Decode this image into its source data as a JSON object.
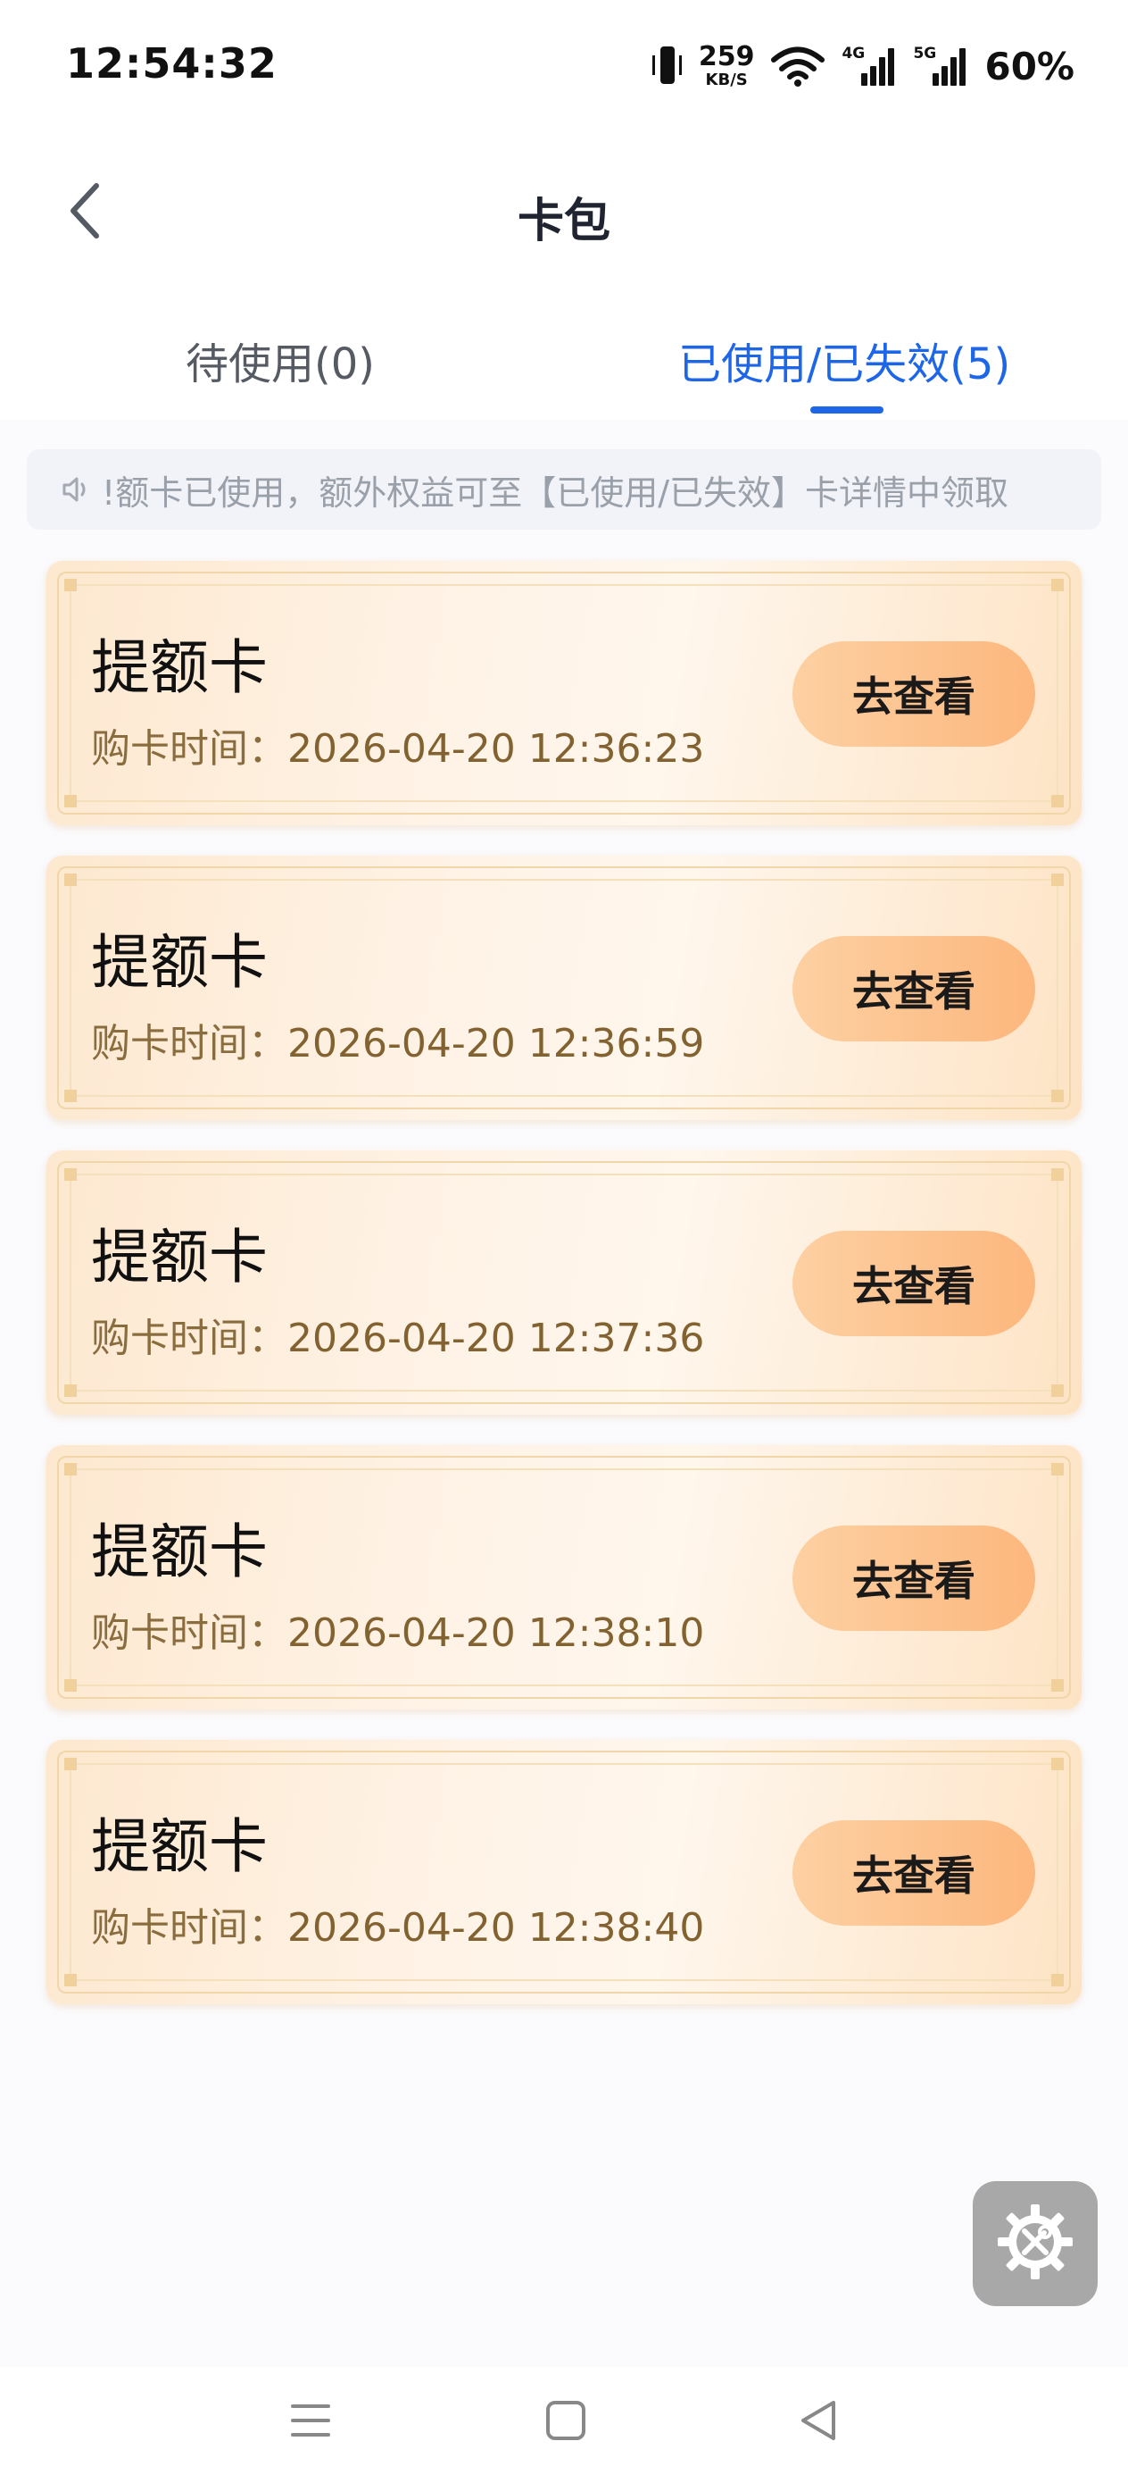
{
  "status_bar": {
    "time": "12:54:32",
    "net_speed_value": "259",
    "net_speed_unit": "KB/S",
    "signal_1_label": "4G",
    "signal_2_label": "5G",
    "battery": "60%",
    "icons": [
      "vibrate-icon",
      "wifi-icon",
      "signal-icon",
      "signal-icon"
    ]
  },
  "header": {
    "title": "卡包",
    "back_icon": "chevron-left-icon"
  },
  "tabs": [
    {
      "label": "待使用(0)",
      "active": false
    },
    {
      "label": "已使用/已失效(5)",
      "active": true
    }
  ],
  "notice": {
    "icon": "speaker-icon",
    "text": "!额卡已使用，额外权益可至【已使用/已失效】卡详情中领取"
  },
  "cards": [
    {
      "title": "提额卡",
      "time_label": "购卡时间：",
      "time_value": "2026-04-20 12:36:23",
      "button": "去查看"
    },
    {
      "title": "提额卡",
      "time_label": "购卡时间：",
      "time_value": "2026-04-20 12:36:59",
      "button": "去查看"
    },
    {
      "title": "提额卡",
      "time_label": "购卡时间：",
      "time_value": "2026-04-20 12:37:36",
      "button": "去查看"
    },
    {
      "title": "提额卡",
      "time_label": "购卡时间：",
      "time_value": "2026-04-20 12:38:10",
      "button": "去查看"
    },
    {
      "title": "提额卡",
      "time_label": "购卡时间：",
      "time_value": "2026-04-20 12:38:40",
      "button": "去查看"
    }
  ],
  "floating_tool": {
    "icon": "gear-tools-icon"
  },
  "system_nav": {
    "icons": [
      "menu-icon",
      "home-icon",
      "back-triangle-icon"
    ]
  },
  "colors": {
    "accent": "#1e66e8",
    "button_gradient_start": "#fdd0a2",
    "button_gradient_end": "#fcb77d",
    "card_time_text": "#826230"
  }
}
